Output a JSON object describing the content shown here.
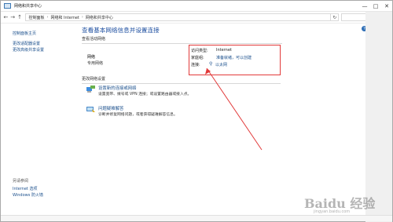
{
  "window": {
    "title": "网络和共享中心",
    "min": "—",
    "max": "□",
    "close": "✕"
  },
  "address": {
    "back": "←",
    "forward": "→",
    "up": "↑",
    "root": "控制面板",
    "seg1": "网络和 Internet",
    "seg2": "网络和共享中心",
    "sep": "›",
    "refresh": "↻",
    "search_icon": "⌕"
  },
  "sidebar": {
    "items": [
      {
        "label": "控制面板主页"
      },
      {
        "label": "更改适配器设置"
      },
      {
        "label": "更改高级共享设置"
      }
    ],
    "see_also": {
      "heading": "另请参阅",
      "links": [
        {
          "label": "Internet 选项"
        },
        {
          "label": "Windows 防火墙"
        }
      ]
    }
  },
  "main": {
    "heading": "查看基本网络信息并设置连接",
    "active_section": "查看活动网络",
    "network_name": "网络",
    "network_type": "专用网络",
    "details": {
      "access_type_label": "访问类型:",
      "access_type_value": "Internet",
      "homegroup_label": "家庭组:",
      "homegroup_value": "准备就绪，可以创建",
      "connections_label": "连接:",
      "connections_value": "以太网"
    },
    "change_section": "更改网络设置",
    "actions": [
      {
        "link": "设置新的连接或网络",
        "desc": "设置宽带、拨号或 VPN 连接；或设置路由器或接入点。"
      },
      {
        "link": "问题疑难解答",
        "desc": "诊断并修复网络问题，或者获得疑难解答信息。"
      }
    ]
  },
  "help": "?",
  "watermark": {
    "text": "Baidu 经验",
    "url": "jingyan.baidu.com"
  },
  "colors": {
    "link": "#1a4f8c",
    "heading": "#1e4fa0",
    "highlight_box": "#e23a3a",
    "arrow": "#e23a3a"
  }
}
